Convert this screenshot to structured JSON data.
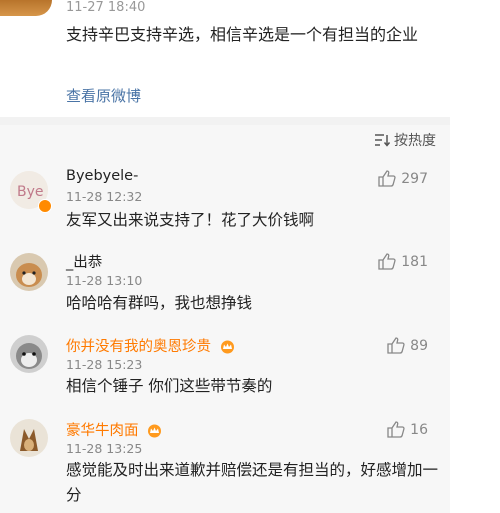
{
  "post": {
    "time": "11-27 18:40",
    "content": "支持辛巴支持辛选，相信辛选是一个有担当的企业",
    "view_original": "查看原微博"
  },
  "sort": {
    "label": "按热度"
  },
  "comments": [
    {
      "name": "Byebyele-",
      "time": "11-28 12:32",
      "text": "友军又出来说支持了！花了大价钱啊",
      "likes": "297"
    },
    {
      "name": "_出恭",
      "time": "11-28 13:10",
      "text": "哈哈哈有群吗，我也想挣钱",
      "likes": "181"
    },
    {
      "name": "你并没有我的奥恩珍贵",
      "time": "11-28 15:23",
      "text": "相信个锤子 你们这些带节奏的",
      "likes": "89"
    },
    {
      "name": "豪华牛肉面",
      "time": "11-28 13:25",
      "text": "感觉能及时出来道歉并赔偿还是有担当的，好感增加一分",
      "likes": "16"
    }
  ],
  "colors": {
    "link": "#4a74a6",
    "vip_name": "#ff7a00",
    "panel_bg": "#f7f7f7"
  },
  "icons": [
    "like-icon",
    "sort-icon",
    "crown-icon"
  ]
}
